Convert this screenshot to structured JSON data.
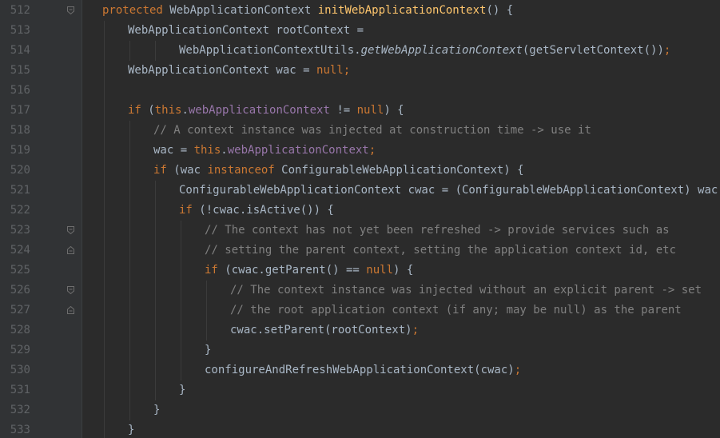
{
  "editor": {
    "colors": {
      "background": "#2b2b2b",
      "gutter": "#313335",
      "line_number": "#606366",
      "keyword": "#cc7832",
      "field": "#9876aa",
      "method_declaration": "#ffc66d",
      "comment": "#808080",
      "text": "#a9b7c6"
    },
    "lines": [
      {
        "number": "512",
        "fold": "fold-collapse-icon",
        "indent": 1,
        "tokens": [
          {
            "t": "protected",
            "c": "kw"
          },
          {
            "t": " WebApplicationContext ",
            "c": "plain"
          },
          {
            "t": "initWebApplicationContext",
            "c": "method"
          },
          {
            "t": "() {",
            "c": "plain"
          }
        ]
      },
      {
        "number": "513",
        "fold": "",
        "indent": 2,
        "tokens": [
          {
            "t": "WebApplicationContext rootContext =",
            "c": "plain"
          }
        ]
      },
      {
        "number": "514",
        "fold": "",
        "indent": 4,
        "tokens": [
          {
            "t": "WebApplicationContextUtils.",
            "c": "plain"
          },
          {
            "t": "getWebApplicationContext",
            "c": "static-m"
          },
          {
            "t": "(getServletContext())",
            "c": "plain"
          },
          {
            "t": ";",
            "c": "punc"
          }
        ]
      },
      {
        "number": "515",
        "fold": "",
        "indent": 2,
        "tokens": [
          {
            "t": "WebApplicationContext wac = ",
            "c": "plain"
          },
          {
            "t": "null",
            "c": "kw"
          },
          {
            "t": ";",
            "c": "punc"
          }
        ]
      },
      {
        "number": "516",
        "fold": "",
        "indent": 0,
        "tokens": []
      },
      {
        "number": "517",
        "fold": "",
        "indent": 2,
        "tokens": [
          {
            "t": "if",
            "c": "kw"
          },
          {
            "t": " (",
            "c": "plain"
          },
          {
            "t": "this",
            "c": "kw"
          },
          {
            "t": ".",
            "c": "plain"
          },
          {
            "t": "webApplicationContext",
            "c": "field"
          },
          {
            "t": " != ",
            "c": "plain"
          },
          {
            "t": "null",
            "c": "kw"
          },
          {
            "t": ") {",
            "c": "plain"
          }
        ]
      },
      {
        "number": "518",
        "fold": "",
        "indent": 3,
        "tokens": [
          {
            "t": "// A context instance was injected at construction time -> use it",
            "c": "cmt"
          }
        ]
      },
      {
        "number": "519",
        "fold": "",
        "indent": 3,
        "tokens": [
          {
            "t": "wac = ",
            "c": "plain"
          },
          {
            "t": "this",
            "c": "kw"
          },
          {
            "t": ".",
            "c": "plain"
          },
          {
            "t": "webApplicationContext",
            "c": "field"
          },
          {
            "t": ";",
            "c": "punc"
          }
        ]
      },
      {
        "number": "520",
        "fold": "",
        "indent": 3,
        "tokens": [
          {
            "t": "if",
            "c": "kw"
          },
          {
            "t": " (wac ",
            "c": "plain"
          },
          {
            "t": "instanceof",
            "c": "kw"
          },
          {
            "t": " ConfigurableWebApplicationContext) {",
            "c": "plain"
          }
        ]
      },
      {
        "number": "521",
        "fold": "",
        "indent": 4,
        "tokens": [
          {
            "t": "ConfigurableWebApplicationContext cwac = (ConfigurableWebApplicationContext) wac",
            "c": "plain"
          },
          {
            "t": ";",
            "c": "punc"
          }
        ]
      },
      {
        "number": "522",
        "fold": "",
        "indent": 4,
        "tokens": [
          {
            "t": "if",
            "c": "kw"
          },
          {
            "t": " (!cwac.isActive()) {",
            "c": "plain"
          }
        ]
      },
      {
        "number": "523",
        "fold": "fold-collapse-icon",
        "indent": 5,
        "tokens": [
          {
            "t": "// The context has not yet been refreshed -> provide services such as",
            "c": "cmt"
          }
        ]
      },
      {
        "number": "524",
        "fold": "fold-expand-icon",
        "indent": 5,
        "tokens": [
          {
            "t": "// setting the parent context, setting the application context id, etc",
            "c": "cmt"
          }
        ]
      },
      {
        "number": "525",
        "fold": "",
        "indent": 5,
        "tokens": [
          {
            "t": "if",
            "c": "kw"
          },
          {
            "t": " (cwac.getParent() == ",
            "c": "plain"
          },
          {
            "t": "null",
            "c": "kw"
          },
          {
            "t": ") {",
            "c": "plain"
          }
        ]
      },
      {
        "number": "526",
        "fold": "fold-collapse-icon",
        "indent": 6,
        "tokens": [
          {
            "t": "// The context instance was injected without an explicit parent -> set",
            "c": "cmt"
          }
        ]
      },
      {
        "number": "527",
        "fold": "fold-expand-icon",
        "indent": 6,
        "tokens": [
          {
            "t": "// the root application context (if any; may be null) as the parent",
            "c": "cmt"
          }
        ]
      },
      {
        "number": "528",
        "fold": "",
        "indent": 6,
        "tokens": [
          {
            "t": "cwac.setParent(rootContext)",
            "c": "plain"
          },
          {
            "t": ";",
            "c": "punc"
          }
        ]
      },
      {
        "number": "529",
        "fold": "",
        "indent": 5,
        "tokens": [
          {
            "t": "}",
            "c": "plain"
          }
        ]
      },
      {
        "number": "530",
        "fold": "",
        "indent": 5,
        "tokens": [
          {
            "t": "configureAndRefreshWebApplicationContext(cwac)",
            "c": "plain"
          },
          {
            "t": ";",
            "c": "punc"
          }
        ]
      },
      {
        "number": "531",
        "fold": "",
        "indent": 4,
        "tokens": [
          {
            "t": "}",
            "c": "plain"
          }
        ]
      },
      {
        "number": "532",
        "fold": "",
        "indent": 3,
        "tokens": [
          {
            "t": "}",
            "c": "plain"
          }
        ]
      },
      {
        "number": "533",
        "fold": "",
        "indent": 2,
        "tokens": [
          {
            "t": "}",
            "c": "plain"
          }
        ]
      }
    ]
  }
}
